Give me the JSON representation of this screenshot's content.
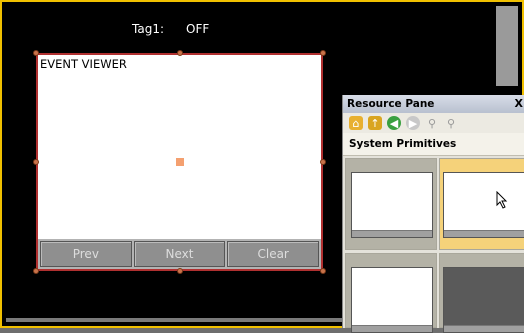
{
  "tag": {
    "label": "Tag1:",
    "value": "OFF"
  },
  "event_viewer": {
    "title": "EVENT VIEWER",
    "buttons": [
      "Prev",
      "Next",
      "Clear"
    ]
  },
  "resource_pane": {
    "title": "Resource Pane",
    "close": "X",
    "section": "System Primitives",
    "tool_icons": [
      "home-folder-icon",
      "folder-up-icon",
      "back-arrow-icon",
      "forward-arrow-icon",
      "zoom-in-icon",
      "zoom-out-icon"
    ]
  },
  "colors": {
    "screen_border": "#f0c000",
    "selection_border": "#b03030",
    "selected_thumb": "#f5d27a"
  }
}
